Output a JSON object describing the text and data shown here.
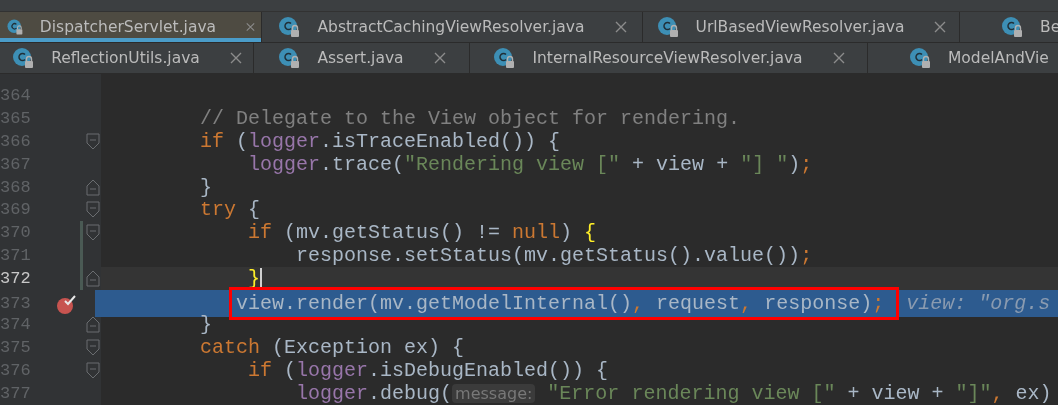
{
  "tab_rows": [
    [
      {
        "label": "DispatcherServlet.java",
        "selected": true,
        "closable": true
      },
      {
        "label": "AbstractCachingViewResolver.java",
        "selected": false,
        "closable": true
      },
      {
        "label": "UrlBasedViewResolver.java",
        "selected": false,
        "closable": true
      },
      {
        "label": "Be",
        "selected": false
      }
    ],
    [
      {
        "label": "ReflectionUtils.java",
        "selected": false,
        "closable": true
      },
      {
        "label": "Assert.java",
        "selected": false,
        "closable": true
      },
      {
        "label": "InternalResourceViewResolver.java",
        "selected": false,
        "closable": true
      },
      {
        "label": "ModelAndVie",
        "selected": false
      }
    ]
  ],
  "lines": [
    {
      "number": "364",
      "fold_open": false,
      "fold_close": false,
      "breakpoint": false,
      "changed": false,
      "caret": false,
      "execution": false,
      "boxed": false
    },
    {
      "number": "365",
      "fold_open": false,
      "fold_close": false,
      "breakpoint": false,
      "changed": false,
      "caret": false,
      "execution": false,
      "boxed": false,
      "tokens": [
        {
          "kind": "comment",
          "text": "        // Delegate to the View object for rendering."
        }
      ]
    },
    {
      "number": "366",
      "fold_open": true,
      "fold_close": false,
      "breakpoint": false,
      "changed": false,
      "caret": false,
      "execution": false,
      "boxed": false,
      "tokens": [
        {
          "kind": "keyword",
          "text": "        if"
        },
        {
          "kind": "plain",
          "text": " ("
        },
        {
          "kind": "field",
          "text": "logger"
        },
        {
          "kind": "plain",
          "text": ".isTraceEnabled()) {"
        }
      ]
    },
    {
      "number": "367",
      "fold_open": false,
      "fold_close": false,
      "breakpoint": false,
      "changed": false,
      "caret": false,
      "execution": false,
      "boxed": false,
      "tokens": [
        {
          "kind": "field",
          "text": "            logger"
        },
        {
          "kind": "plain",
          "text": ".trace("
        },
        {
          "kind": "string",
          "text": "\"Rendering view [\""
        },
        {
          "kind": "plain",
          "text": " + view + "
        },
        {
          "kind": "string",
          "text": "\"] \""
        },
        {
          "kind": "plain",
          "text": ")"
        },
        {
          "kind": "keyword",
          "text": ";"
        }
      ]
    },
    {
      "number": "368",
      "fold_open": false,
      "fold_close": true,
      "breakpoint": false,
      "changed": false,
      "caret": false,
      "execution": false,
      "boxed": false,
      "tokens": [
        {
          "kind": "plain",
          "text": "        }"
        }
      ]
    },
    {
      "number": "369",
      "fold_open": true,
      "fold_close": false,
      "breakpoint": false,
      "changed": false,
      "caret": false,
      "execution": false,
      "boxed": false,
      "tokens": [
        {
          "kind": "keyword",
          "text": "        try"
        },
        {
          "kind": "plain",
          "text": " {"
        }
      ]
    },
    {
      "number": "370",
      "fold_open": true,
      "fold_close": false,
      "breakpoint": false,
      "changed": true,
      "caret": false,
      "execution": false,
      "boxed": false,
      "tokens": [
        {
          "kind": "keyword",
          "text": "            if"
        },
        {
          "kind": "plain",
          "text": " (mv.getStatus() != "
        },
        {
          "kind": "keyword",
          "text": "null"
        },
        {
          "kind": "plain",
          "text": ") "
        },
        {
          "kind": "brace_match",
          "text": "{"
        }
      ]
    },
    {
      "number": "371",
      "fold_open": false,
      "fold_close": false,
      "breakpoint": false,
      "changed": true,
      "caret": false,
      "execution": false,
      "boxed": false,
      "tokens": [
        {
          "kind": "plain",
          "text": "                response.setStatus(mv.getStatus().value())"
        },
        {
          "kind": "keyword",
          "text": ";"
        }
      ]
    },
    {
      "number": "372",
      "fold_open": false,
      "fold_close": true,
      "breakpoint": false,
      "changed": true,
      "caret": true,
      "execution": false,
      "boxed": false,
      "tokens": [
        {
          "kind": "brace_match",
          "text": "            }"
        }
      ]
    },
    {
      "number": "373",
      "fold_open": false,
      "fold_close": false,
      "breakpoint": true,
      "changed": false,
      "caret": false,
      "execution": true,
      "boxed": true,
      "tokens": [
        {
          "kind": "plain",
          "text": "view.render(mv.getModelInternal()"
        },
        {
          "kind": "keyword",
          "text": ", "
        },
        {
          "kind": "plain",
          "text": "request"
        },
        {
          "kind": "keyword",
          "text": ", "
        },
        {
          "kind": "plain",
          "text": "response)"
        },
        {
          "kind": "keyword",
          "text": ";"
        }
      ],
      "hint": "view: \"org.s"
    },
    {
      "number": "374",
      "fold_open": false,
      "fold_close": true,
      "breakpoint": false,
      "changed": false,
      "caret": false,
      "execution": false,
      "boxed": false,
      "tokens": [
        {
          "kind": "plain",
          "text": "        }"
        }
      ]
    },
    {
      "number": "375",
      "fold_open": true,
      "fold_close": false,
      "breakpoint": false,
      "changed": false,
      "caret": false,
      "execution": false,
      "boxed": false,
      "tokens": [
        {
          "kind": "keyword",
          "text": "        catch"
        },
        {
          "kind": "plain",
          "text": " (Exception ex) {"
        }
      ]
    },
    {
      "number": "376",
      "fold_open": true,
      "fold_close": false,
      "breakpoint": false,
      "changed": false,
      "caret": false,
      "execution": false,
      "boxed": false,
      "tokens": [
        {
          "kind": "keyword",
          "text": "            if"
        },
        {
          "kind": "plain",
          "text": " ("
        },
        {
          "kind": "field",
          "text": "logger"
        },
        {
          "kind": "plain",
          "text": ".isDebugEnabled()) {"
        }
      ]
    },
    {
      "number": "377",
      "fold_open": false,
      "fold_close": false,
      "breakpoint": false,
      "changed": false,
      "caret": false,
      "execution": false,
      "boxed": false,
      "tokens": [
        {
          "kind": "field",
          "text": "                logger"
        },
        {
          "kind": "plain",
          "text": ".debug("
        },
        {
          "kind": "param_hint",
          "text": "message:"
        },
        {
          "kind": "string",
          "text": " \"Error rendering view [\""
        },
        {
          "kind": "plain",
          "text": " + view + "
        },
        {
          "kind": "string",
          "text": "\"]\""
        },
        {
          "kind": "keyword",
          "text": ","
        },
        {
          "kind": "plain",
          "text": " ex)"
        }
      ]
    }
  ]
}
